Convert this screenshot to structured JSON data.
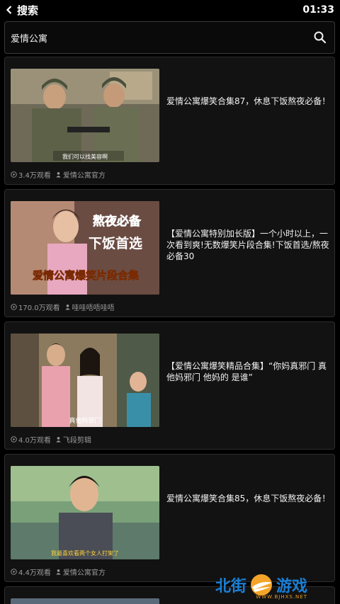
{
  "status_bar": {
    "title": "搜索",
    "time": "01:33"
  },
  "search": {
    "value": "爱情公寓",
    "placeholder": ""
  },
  "videos": [
    {
      "title": "爱情公寓爆笑合集87，休息下饭熬夜必备！",
      "views": "3.4万观看",
      "author": "爱情公寓官方",
      "thumb_caption": "我们可以找美容啊",
      "thumb_overlay": ""
    },
    {
      "title": "【爱情公寓特别加长版】一个小时以上，一次看到爽!无数爆笑片段合集!下饭首选/熬夜必备30",
      "views": "170.0万观看",
      "author": "哇哇唔唔哇唔",
      "thumb_caption": "",
      "thumb_overlay": [
        "熬夜必备",
        "下饭首选",
        "爱情公寓爆笑片段合集"
      ]
    },
    {
      "title": "【爱情公寓爆笑精品合集】“你妈真邪门 真他妈邪门 他妈的 是谁”",
      "views": "4.0万观看",
      "author": "飞段剪辑",
      "thumb_caption": "真他妈邪门",
      "thumb_overlay": ""
    },
    {
      "title": "爱情公寓爆笑合集85，休息下饭熬夜必备！",
      "views": "4.4万观看",
      "author": "爱情公寓官方",
      "thumb_caption": "我最喜欢看两个女人打架了",
      "thumb_overlay": ""
    }
  ],
  "watermark": {
    "left": "北街",
    "right": "游戏",
    "url": "WWW.BJHXS.NET"
  },
  "colors": {
    "background": "#000000",
    "card": "#121212",
    "accent": "#1a7fd6"
  },
  "icons": {
    "back": "back-arrow-icon",
    "search": "search-icon",
    "views": "play-circle-icon",
    "author": "user-icon"
  }
}
